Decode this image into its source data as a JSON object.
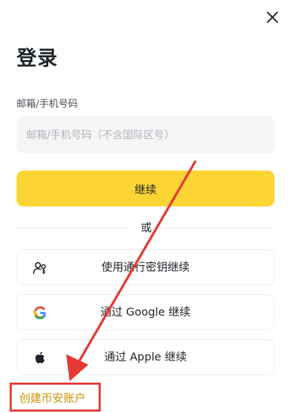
{
  "header": {
    "close_icon": "close-icon",
    "title": "登录"
  },
  "login_form": {
    "field_label": "邮箱/手机号码",
    "field_value": "",
    "field_placeholder": "邮箱/手机号码（不含国际区号）",
    "continue_label": "继续"
  },
  "divider": {
    "text": "或"
  },
  "alt_options": [
    {
      "label": "使用通行密钥继续",
      "icon": "passkey-icon"
    },
    {
      "label": "通过 Google 继续",
      "icon": "google-icon"
    },
    {
      "label": "通过 Apple 继续",
      "icon": "apple-icon"
    }
  ],
  "footer": {
    "signup_label": "创建币安账户"
  },
  "annotation": {
    "color": "#e53935"
  },
  "colors": {
    "accent": "#fcd535",
    "link": "#c99400",
    "text": "#1e2329",
    "input_bg": "#f5f5f5",
    "border": "#eaecef"
  }
}
